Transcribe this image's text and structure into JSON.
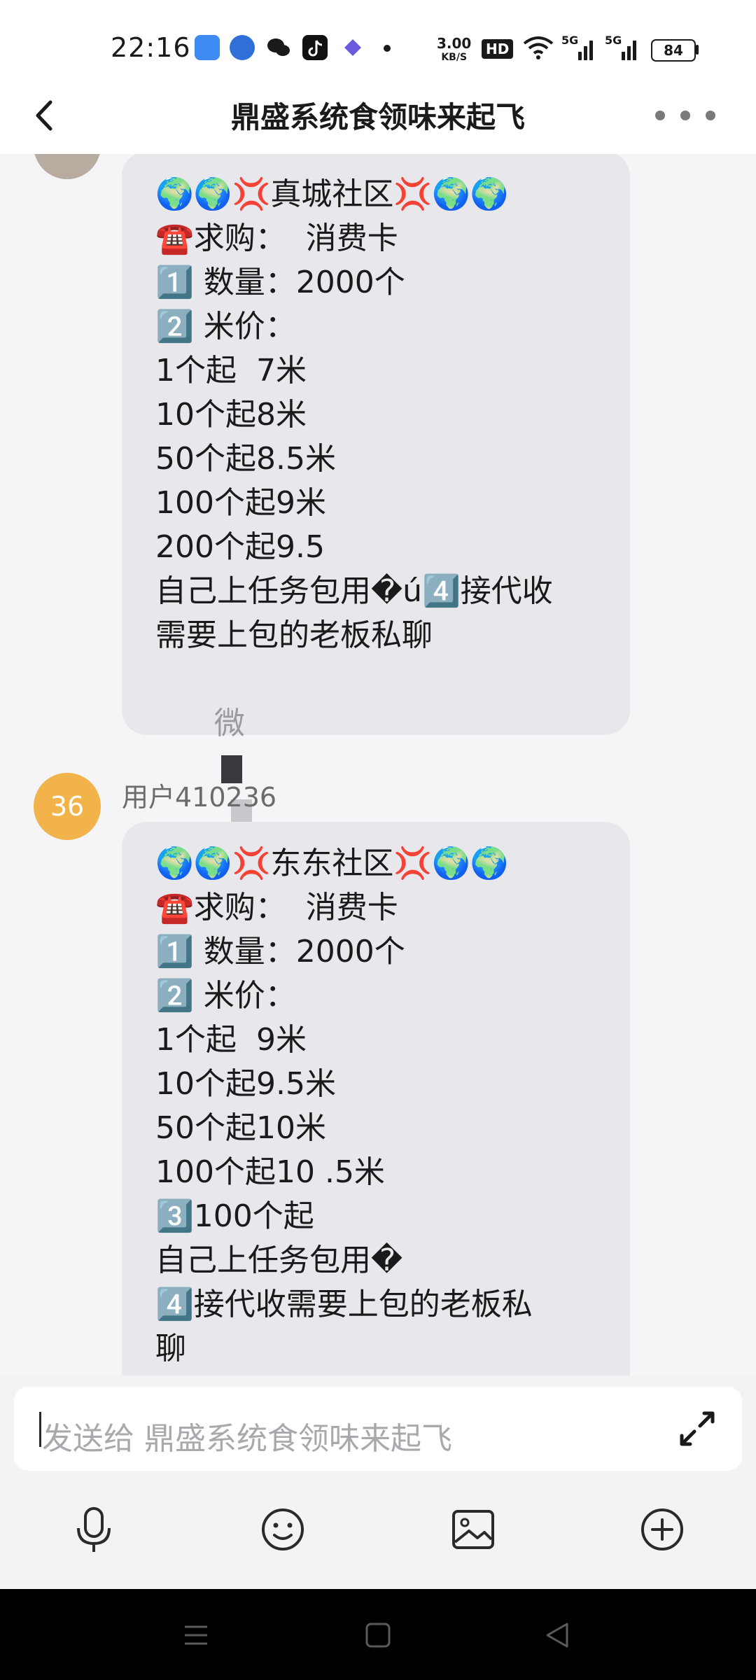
{
  "status_bar": {
    "time": "22:16",
    "network_speed": "3.00",
    "network_unit": "KB/S",
    "hd_badge": "HD",
    "signal_1": "5G",
    "signal_2": "5G",
    "battery": "84",
    "icons": [
      "blue-app-icon",
      "vpn-app-icon",
      "wechat-icon",
      "tiktok-icon",
      "diamond-app-icon",
      "dot-icon",
      "wifi-icon"
    ]
  },
  "header": {
    "title": "鼎盛系统食领味来起飞"
  },
  "messages": [
    {
      "avatar_text": "",
      "sender": "",
      "lines": [
        "🌍🌍💢真城社区💢🌍🌍",
        "☎️求购：  消费卡",
        "1️⃣ 数量：2000个",
        "2️⃣ 米价：",
        "1个起  7米",
        "10个起8米",
        "50个起8.5米",
        "100个起9米",
        "200个起9.5",
        "自己上任务包用�ú4️⃣接代收",
        "需要上包的老板私聊",
        "微"
      ]
    },
    {
      "avatar_text": "36",
      "sender": "用户410236",
      "lines": [
        "🌍🌍💢东东社区💢🌍🌍",
        "☎️求购：  消费卡",
        "1️⃣ 数量：2000个",
        "2️⃣ 米价：",
        "1个起  9米",
        "10个起9.5米",
        "50个起10米",
        "100个起10 .5米",
        "3️⃣100个起",
        "自己上任务包用�",
        "4️⃣接代收需要上包的老板私",
        "聊"
      ]
    }
  ],
  "input": {
    "placeholder": "发送给 鼎盛系统食领味来起飞"
  },
  "toolbar": [
    "microphone-icon",
    "emoji-icon",
    "image-icon",
    "plus-icon"
  ],
  "colors": {
    "avatar_orange": "#f2b34a",
    "bubble_bg": "#e8e8ec",
    "chat_bg": "#f5f5f7"
  }
}
